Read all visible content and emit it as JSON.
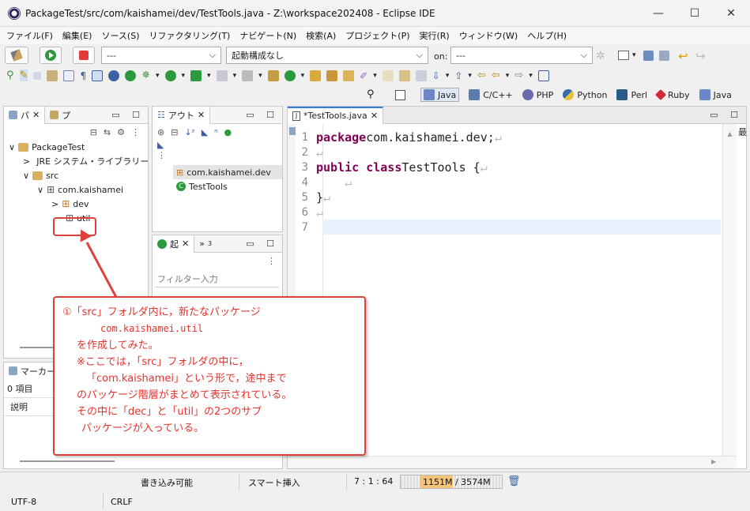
{
  "window": {
    "title": "PackageTest/src/com/kaishamei/dev/TestTools.java - Z:\\workspace202408 - Eclipse IDE",
    "minimize": "—",
    "maximize": "☐",
    "close": "✕"
  },
  "menu": [
    "ファイル(F)",
    "編集(E)",
    "ソース(S)",
    "リファクタリング(T)",
    "ナビゲート(N)",
    "検索(A)",
    "プロジェクト(P)",
    "実行(R)",
    "ウィンドウ(W)",
    "ヘルプ(H)"
  ],
  "toolbar": {
    "launch_mode_value": "---",
    "launch_config_value": "起動構成なし",
    "on_label": "on:",
    "target_value": "---"
  },
  "perspectives": [
    "Java",
    "C/C++",
    "PHP",
    "Python",
    "Perl",
    "Ruby",
    "Java"
  ],
  "package_explorer": {
    "tab_label": "パ",
    "tab2_label": "プ",
    "tree": [
      {
        "label": "PackageTest",
        "depth": 0,
        "arrow": "∨"
      },
      {
        "label": "JRE システム・ライブラリー [",
        "depth": 1,
        "arrow": ">"
      },
      {
        "label": "src",
        "depth": 1,
        "arrow": "∨"
      },
      {
        "label": "com.kaishamei",
        "depth": 2,
        "arrow": "∨"
      },
      {
        "label": "dev",
        "depth": 3,
        "arrow": ">"
      },
      {
        "label": "util",
        "depth": 3,
        "arrow": ""
      }
    ]
  },
  "outline": {
    "tab_label": "アウト",
    "items": [
      "com.kaishamei.dev",
      "TestTools"
    ]
  },
  "launcher": {
    "tab_label": "起",
    "tab2_label": "»",
    "tab2_count": "3",
    "filter_placeholder": "フィルター入力"
  },
  "markers": {
    "tab_label": "マーカー",
    "count": "0 項目",
    "column": "説明"
  },
  "editor": {
    "tab_label": "*TestTools.java",
    "lines": [
      {
        "n": "1",
        "kw": "package",
        "rest": " com.kaishamei.dev;"
      },
      {
        "n": "2",
        "kw": "",
        "rest": ""
      },
      {
        "n": "3",
        "kw": "public class",
        "rest": " TestTools {"
      },
      {
        "n": "4",
        "kw": "",
        "rest": ""
      },
      {
        "n": "5",
        "kw": "",
        "rest": "}"
      },
      {
        "n": "6",
        "kw": "",
        "rest": ""
      },
      {
        "n": "7",
        "kw": "",
        "rest": ""
      }
    ],
    "right_hint": "最"
  },
  "status": {
    "writable": "書き込み可能",
    "insert_mode": "スマート挿入",
    "position": "7 : 1 : 64",
    "heap": "1151M / 3574M",
    "encoding": "UTF-8",
    "line_ending": "CRLF"
  },
  "callout": {
    "line1": "①「src」フォルダ内に，新たなパッケージ",
    "line2": "com.kaishamei.util",
    "line3": "を作成してみた。",
    "line4": "※ここでは，「src」フォルダの中に，",
    "line5": "「com.kaishamei」という形で，途中まで",
    "line6": "のパッケージ階層がまとめて表示されている。",
    "line7": "その中に「dec」と「util」の2つのサブ",
    "line8": "パッケージが入っている。"
  },
  "colors": {
    "accent_red": "#e0403a",
    "keyword": "#7f0055",
    "current_line": "#e8f2fe",
    "heap_fill": "#f5c27a"
  }
}
